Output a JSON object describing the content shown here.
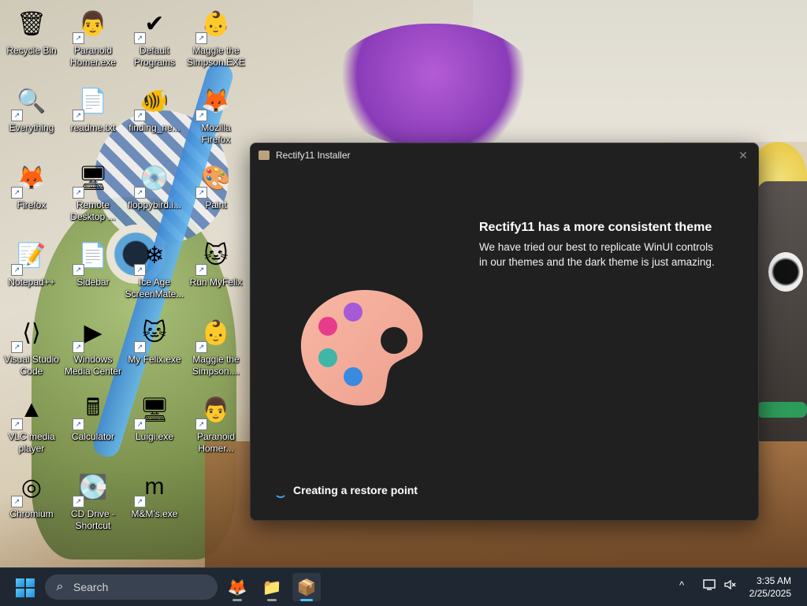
{
  "desktop": {
    "icons": [
      {
        "label": "Recycle Bin",
        "icon": "recycle-bin-icon",
        "glyph": "🗑"
      },
      {
        "label": "Paranoid\nHomer.exe",
        "icon": "homer-icon",
        "glyph": "👨"
      },
      {
        "label": "Default\nPrograms",
        "icon": "default-programs-icon",
        "glyph": "✔"
      },
      {
        "label": "Maggie the\nSimpson.EXE",
        "icon": "maggie-icon",
        "glyph": "👶"
      },
      {
        "label": "Everything",
        "icon": "everything-search-icon",
        "glyph": "🔍"
      },
      {
        "label": "readme.txt",
        "icon": "text-file-icon",
        "glyph": "📄"
      },
      {
        "label": "finding_ne...",
        "icon": "nemo-icon",
        "glyph": "🐠"
      },
      {
        "label": "Mozilla\nFirefox",
        "icon": "firefox-icon",
        "glyph": "🦊"
      },
      {
        "label": "Firefox",
        "icon": "firefox-icon",
        "glyph": "🦊"
      },
      {
        "label": "Remote\nDesktop ...",
        "icon": "remote-desktop-icon",
        "glyph": "🖥"
      },
      {
        "label": "floppybird.i...",
        "icon": "disc-image-icon",
        "glyph": "💿"
      },
      {
        "label": "Paint",
        "icon": "paint-icon",
        "glyph": "🎨"
      },
      {
        "label": "Notepad++",
        "icon": "notepad-plus-plus-icon",
        "glyph": "📝"
      },
      {
        "label": "Sidebar",
        "icon": "blank-file-icon",
        "glyph": "📄"
      },
      {
        "label": "Ice Age\nScreenMate...",
        "icon": "ice-age-icon",
        "glyph": "❄"
      },
      {
        "label": "Run MyFelix",
        "icon": "felix-cat-icon",
        "glyph": "🐱"
      },
      {
        "label": "Visual Studio\nCode",
        "icon": "vscode-icon",
        "glyph": "⟨⟩"
      },
      {
        "label": "Windows\nMedia Center",
        "icon": "media-center-icon",
        "glyph": "▶"
      },
      {
        "label": "My Felix.exe",
        "icon": "felix-cat-icon",
        "glyph": "🐱"
      },
      {
        "label": "Maggie the\nSimpson....",
        "icon": "maggie-icon",
        "glyph": "👶"
      },
      {
        "label": "VLC media\nplayer",
        "icon": "vlc-icon",
        "glyph": "▲"
      },
      {
        "label": "Calculator",
        "icon": "calculator-icon",
        "glyph": "🖩"
      },
      {
        "label": "Luigi.exe",
        "icon": "luigi-icon",
        "glyph": "🖥"
      },
      {
        "label": "Paranoid\nHomer...",
        "icon": "homer-icon",
        "glyph": "👨"
      },
      {
        "label": "Chromium",
        "icon": "chromium-icon",
        "glyph": "◎"
      },
      {
        "label": "CD Drive -\nShortcut",
        "icon": "cd-drive-icon",
        "glyph": "💽"
      },
      {
        "label": "M&M's.exe",
        "icon": "mms-icon",
        "glyph": "m"
      }
    ]
  },
  "window": {
    "title": "Rectify11 Installer",
    "close_glyph": "✕",
    "headline": "Rectify11 has a more consistent theme",
    "description": "We have tried our best to replicate WinUI controls in our themes and the dark theme is just amazing.",
    "status": "Creating a restore point"
  },
  "taskbar": {
    "search_placeholder": "Search",
    "apps": [
      {
        "name": "taskbar-firefox",
        "icon": "firefox-icon",
        "glyph": "🦊",
        "active": false
      },
      {
        "name": "taskbar-file-explorer",
        "icon": "folder-icon",
        "glyph": "📁",
        "active": false
      },
      {
        "name": "taskbar-rectify11-installer",
        "icon": "installer-icon",
        "glyph": "📦",
        "active": true
      }
    ],
    "tray": {
      "chevron": "^",
      "network_icon": "network-icon",
      "volume_icon": "volume-muted-icon"
    },
    "time": "3:35 AM",
    "date": "2/25/2025"
  },
  "colors": {
    "window_bg": "#202020",
    "taskbar_bg": "#1f2732",
    "accent": "#4cc2ff"
  }
}
